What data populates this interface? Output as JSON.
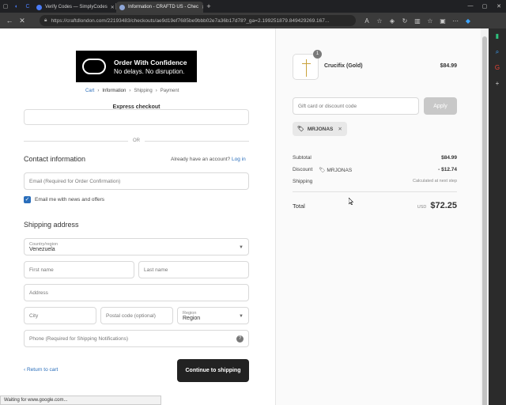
{
  "browser": {
    "tabs": [
      {
        "title": "Verify Codes — SimplyCodes",
        "favicon_color": "#4a7cf7"
      },
      {
        "title": "Information - CRAFTD US - Chec",
        "favicon_color": "#8fa7d8"
      }
    ],
    "new_tab": "+",
    "url": "https://craftdlondon.com/22193483/checkouts/ae9d19ef7685be9bbb02e7a36b17d78?_ga=2.199251879.849429269.167...",
    "status": "Waiting for www.google.com..."
  },
  "banner": {
    "title": "Order With Confidence",
    "subtitle": "No delays. No disruption."
  },
  "breadcrumb": {
    "items": [
      "Cart",
      "›",
      "Information",
      "›",
      "Shipping",
      "›",
      "Payment"
    ]
  },
  "express": {
    "title": "Express checkout",
    "or": "OR"
  },
  "contact": {
    "title": "Contact information",
    "account_prompt": "Already have an account?",
    "login": "Log in",
    "email_placeholder": "Email (Required for Order Confirmation)",
    "newsletter_label": "Email me with news and offers",
    "newsletter_checked": true
  },
  "shipping": {
    "title": "Shipping address",
    "country_label": "Country/region",
    "country_value": "Venezuela",
    "first_name": "First name",
    "last_name": "Last name",
    "address": "Address",
    "city": "City",
    "postal": "Postal code (optional)",
    "region_label": "Region",
    "region_value": "Region",
    "phone": "Phone (Required for Shipping Notifications)"
  },
  "actions": {
    "return": "Return to cart",
    "continue": "Continue to shipping"
  },
  "summary": {
    "product": {
      "name": "Crucifix (Gold)",
      "price": "$84.99",
      "qty": "1"
    },
    "discount_placeholder": "Gift card or discount code",
    "apply": "Apply",
    "applied_code": "MRJONAS",
    "subtotal_label": "Subtotal",
    "subtotal": "$84.99",
    "discount_label": "Discount",
    "discount_code": "MRJONAS",
    "discount": "- $12.74",
    "shipping_label": "Shipping",
    "shipping": "Calculated at next step",
    "total_label": "Total",
    "currency": "USD",
    "total": "$72.25"
  }
}
